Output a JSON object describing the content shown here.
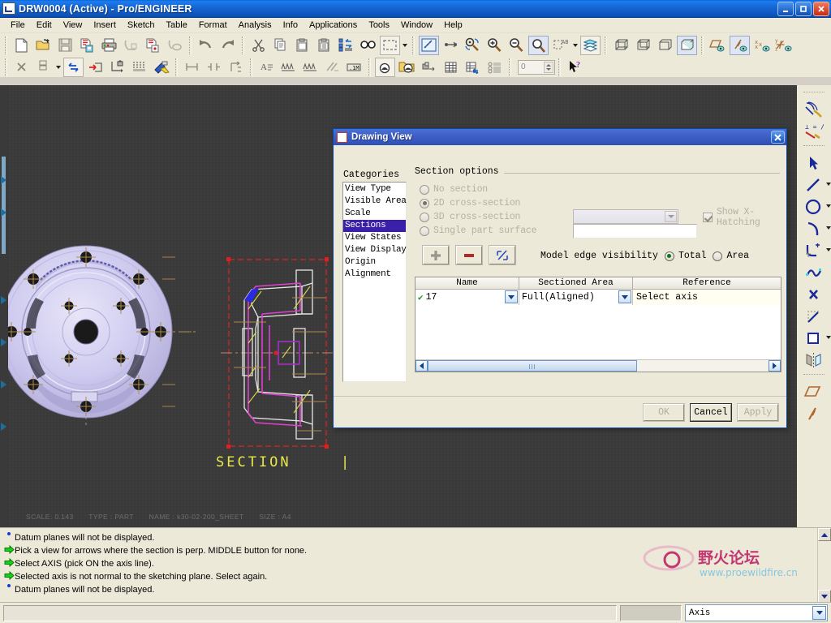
{
  "window": {
    "title": "DRW0004 (Active) - Pro/ENGINEER",
    "minimize": "_",
    "maximize": "□",
    "close": "✕"
  },
  "menubar": {
    "items": [
      {
        "label": "File"
      },
      {
        "label": "Edit"
      },
      {
        "label": "View"
      },
      {
        "label": "Insert"
      },
      {
        "label": "Sketch"
      },
      {
        "label": "Table"
      },
      {
        "label": "Format"
      },
      {
        "label": "Analysis"
      },
      {
        "label": "Info"
      },
      {
        "label": "Applications"
      },
      {
        "label": "Tools"
      },
      {
        "label": "Window"
      },
      {
        "label": "Help"
      }
    ]
  },
  "toolbar_row1": {
    "icons": [
      "new-file-icon",
      "open-folder-icon",
      "save-icon",
      "save-as-pdf-icon",
      "print-icon",
      "mail-icon",
      "export-icon",
      "link-icon",
      "undo-icon",
      "redo-icon",
      "cut-icon",
      "copy-icon",
      "paste-icon",
      "paste-special-icon",
      "regenerate-icon",
      "find-icon",
      "selection-box-icon",
      "repaint-icon",
      "refit-icon",
      "zoom-in-icon",
      "zoom-out-icon",
      "zoom-area-icon",
      "sheet-setup-icon",
      "layers-icon",
      "view-wireframe-icon",
      "view-hidden-line-icon",
      "view-no-hidden-icon",
      "view-shaded-icon",
      "datum-plane-display-icon",
      "datum-axis-display-icon",
      "datum-point-display-icon",
      "coord-system-display-icon"
    ]
  },
  "toolbar_row2": {
    "spinner_value": "0",
    "icons": [
      "delete-icon",
      "repeat-icon",
      "update-sheet-icon",
      "lock-icon",
      "table-lines-icon",
      "erase-icon",
      "dimension-icon",
      "ordinate-dim-icon",
      "note-icon",
      "geom-tol-icon",
      "surface-finish-icon",
      "balloon-icon",
      "table-icon",
      "table-update-icon",
      "bom-icon",
      "help-cursor-icon"
    ]
  },
  "right_toolbar": {
    "icons": [
      "sketch-annotate-icon",
      "constraint-icon",
      "select-arrow-icon",
      "line-icon",
      "circle-icon",
      "arc-icon",
      "fillet-icon",
      "spline-icon",
      "point-icon",
      "coord-sys-icon",
      "rectangle-icon",
      "mirror-icon",
      "datum-plane-icon",
      "datum-axis-icon"
    ]
  },
  "drawing": {
    "status": {
      "scale_label": "SCALE: 0.143",
      "type_label": "TYPE : PART",
      "name_label": "NAME : k30-02-200_SHEET",
      "size_label": "SIZE : A4"
    },
    "section_label": "SECTION"
  },
  "dialog": {
    "title": "Drawing View",
    "close_label": "✕",
    "categories_label": "Categories",
    "categories": [
      {
        "label": "View Type",
        "selected": false
      },
      {
        "label": "Visible Area",
        "selected": false
      },
      {
        "label": "Scale",
        "selected": false
      },
      {
        "label": "Sections",
        "selected": true
      },
      {
        "label": "View States",
        "selected": false
      },
      {
        "label": "View Display",
        "selected": false
      },
      {
        "label": "Origin",
        "selected": false
      },
      {
        "label": "Alignment",
        "selected": false
      }
    ],
    "panel_legend": "Section options",
    "options": [
      {
        "label": "No section",
        "selected": false,
        "enabled": false
      },
      {
        "label": "2D cross-section",
        "selected": true,
        "enabled": false
      },
      {
        "label": "3D cross-section",
        "selected": false,
        "enabled": false
      },
      {
        "label": "Single part surface",
        "selected": false,
        "enabled": false
      }
    ],
    "show_xhatching_label": "Show X-Hatching",
    "show_xhatching_checked": true,
    "action_buttons": [
      {
        "name": "add-section-button",
        "glyph": "+"
      },
      {
        "name": "remove-section-button",
        "glyph": "−"
      },
      {
        "name": "edit-section-button",
        "glyph": "⇱"
      }
    ],
    "model_edge_visibility_label": "Model edge visibility",
    "edge_total_label": "Total",
    "edge_area_label": "Area",
    "edge_selected": "Total",
    "table": {
      "columns": [
        "Name",
        "Sectioned Area",
        "Reference"
      ],
      "rows": [
        {
          "name": "17",
          "sectioned_area": "Full(Aligned)",
          "reference": "Select axis",
          "checked": true
        }
      ]
    },
    "buttons": [
      {
        "label": "OK",
        "enabled": false
      },
      {
        "label": "Cancel",
        "enabled": true
      },
      {
        "label": "Apply",
        "enabled": false
      }
    ]
  },
  "messages": [
    {
      "type": "info",
      "text": "Datum planes will not be displayed."
    },
    {
      "type": "prompt",
      "text": "Pick a view for arrows where the section is perp. MIDDLE button for none."
    },
    {
      "type": "prompt",
      "text": "Select AXIS (pick ON the axis line)."
    },
    {
      "type": "prompt",
      "text": "Selected axis is not normal to the sketching plane. Select again."
    },
    {
      "type": "info",
      "text": "Datum planes will not be displayed."
    }
  ],
  "statusbar": {
    "selection_filter": "Axis"
  },
  "watermark": {
    "title": "野火论坛",
    "url": "www.proewildfire.cn"
  },
  "colors": {
    "title_blue": "#1667d4",
    "dialog_blue": "#3d5fc6",
    "selection_purple": "#3a1fa8",
    "canvas": "#3a3a3a",
    "panel": "#ece9d8",
    "section_yellow": "#e8e84a",
    "section_magenta": "#e040d0",
    "selection_red": "#e02020",
    "part_lavender": "#ccc8ee",
    "prompt_green": "#12c412",
    "info_blue": "#1a39d8"
  }
}
